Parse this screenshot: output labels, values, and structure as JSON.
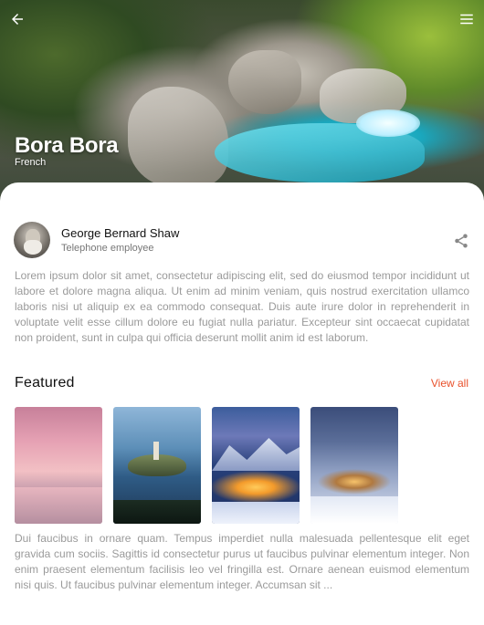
{
  "hero": {
    "title": "Bora Bora",
    "subtitle": "French"
  },
  "nav": {
    "back_icon": "arrow-left-icon",
    "menu_icon": "hamburger-menu-icon"
  },
  "author": {
    "name": "George Bernard Shaw",
    "role": "Telephone employee"
  },
  "share_icon": "share-icon",
  "description": "Lorem ipsum dolor sit amet, consectetur adipiscing elit, sed do eiusmod tempor incididunt ut labore et dolore magna aliqua. Ut enim ad minim veniam, quis nostrud exercitation ullamco laboris nisi ut aliquip ex ea commodo consequat. Duis aute irure dolor in reprehenderit in voluptate velit esse cillum dolore eu fugiat nulla pariatur. Excepteur sint occaecat cupidatat non proident, sunt in culpa qui officia deserunt mollit anim id est laborum.",
  "featured": {
    "heading": "Featured",
    "view_all": "View all"
  },
  "footer_text": "Dui faucibus in ornare quam. Tempus imperdiet nulla malesuada pellentesque elit eget gravida cum sociis. Sagittis id consectetur purus ut faucibus pulvinar elementum integer. Non enim praesent elementum facilisis leo vel fringilla est. Ornare aenean euismod elementum nisi quis. Ut faucibus pulvinar elementum integer. Accumsan sit ...",
  "colors": {
    "accent": "#e8502b",
    "text_muted": "#9a9a9a",
    "heading": "#111111"
  }
}
